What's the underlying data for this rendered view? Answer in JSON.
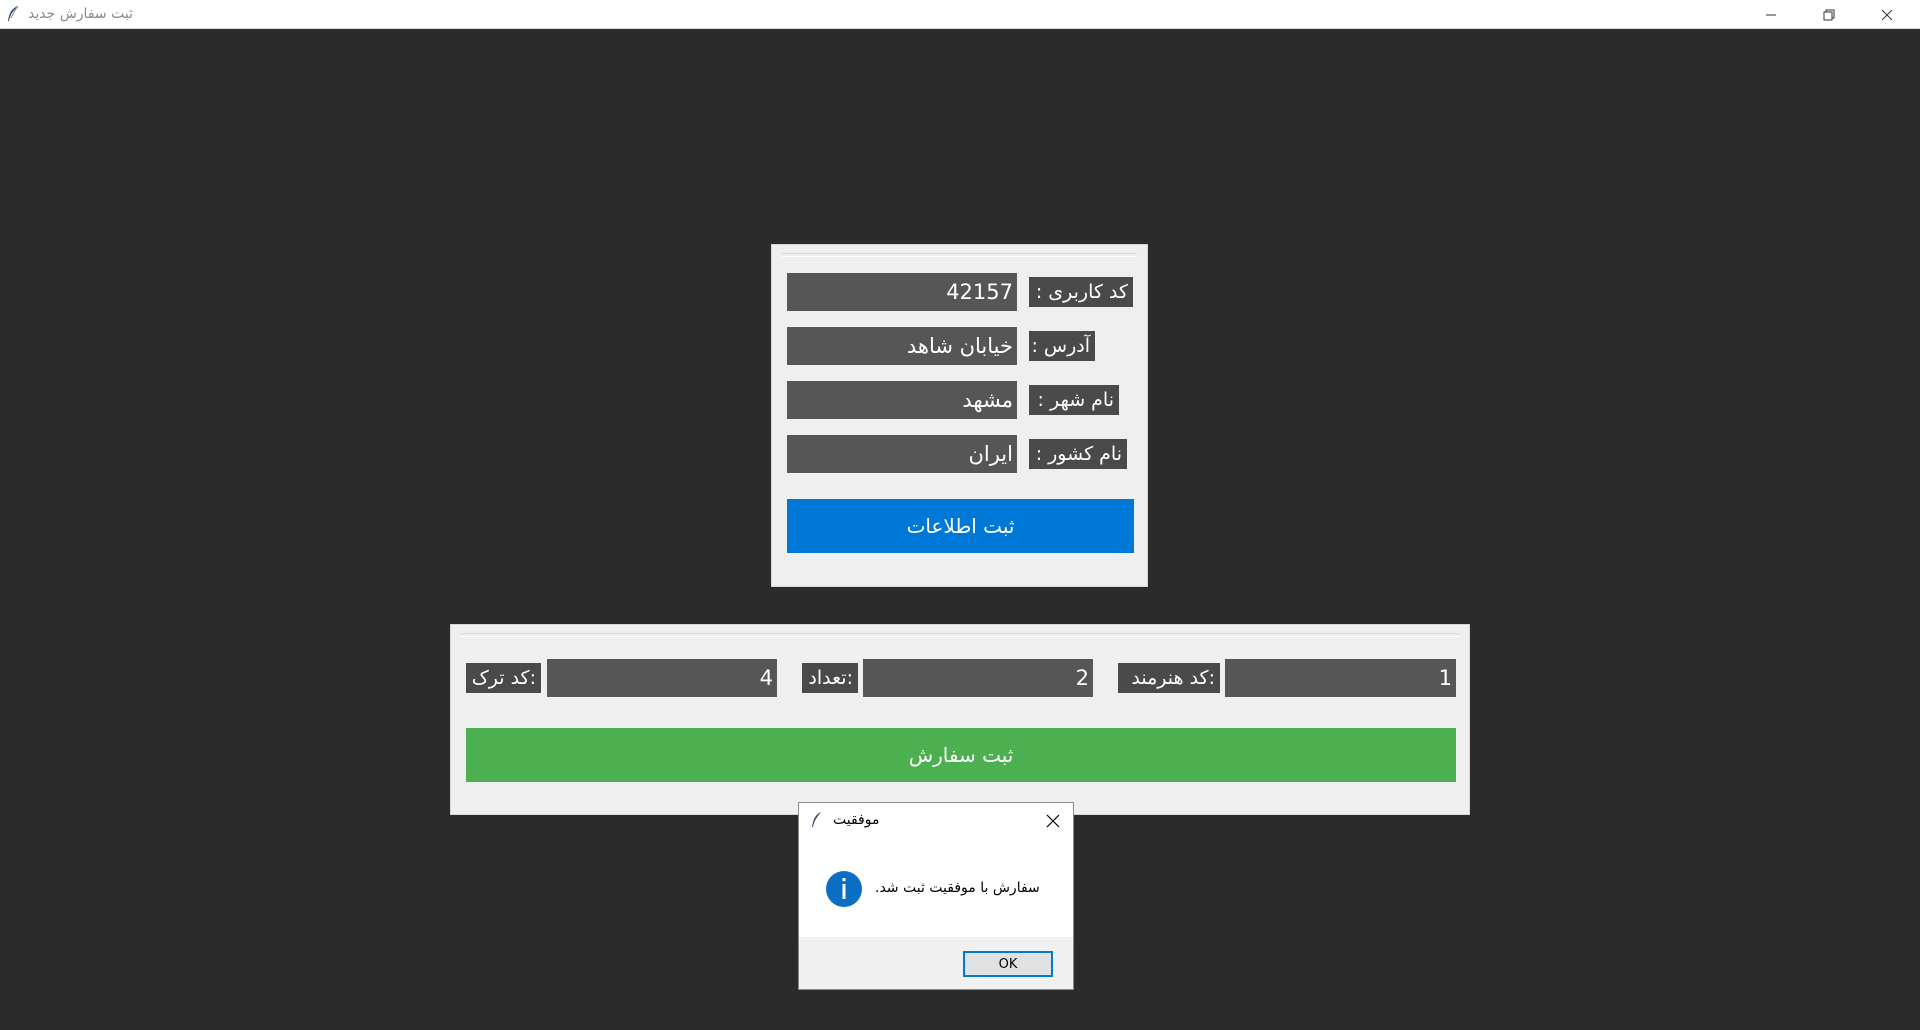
{
  "window": {
    "title": "ثبت سفارش جدید"
  },
  "user_form": {
    "user_code_label": "کد کاربری :",
    "user_code_value": "42157",
    "address_label": "آدرس :",
    "address_value": "خیابان شاهد",
    "city_label": "نام شهر :",
    "city_value": "مشهد",
    "country_label": "نام کشور :",
    "country_value": "ایران",
    "submit_label": "ثبت اطلاعات"
  },
  "order_form": {
    "track_code_label": ":کد ترک",
    "track_code_value": "4",
    "quantity_label": ":تعداد",
    "quantity_value": "2",
    "artist_code_label": ":کد هنرمند",
    "artist_code_value": "1",
    "submit_label": "ثبت سفارش"
  },
  "dialog": {
    "title": "موفقیت",
    "message": ".سفارش با موفقیت ثبت شد",
    "ok_label": "OK",
    "icon": "info-icon"
  },
  "colors": {
    "background": "#2b2b2b",
    "panel": "#efefef",
    "field": "#565656",
    "primary_blue": "#0078d7",
    "success_green": "#4caf50"
  }
}
